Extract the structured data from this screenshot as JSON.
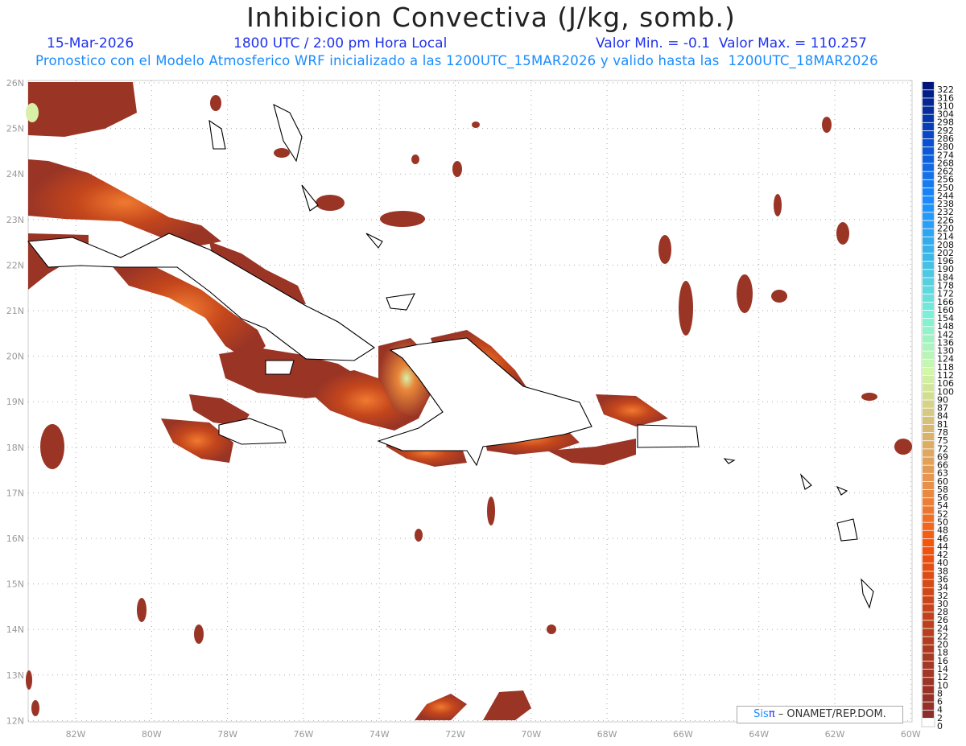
{
  "header": {
    "title": "Inhibicion Convectiva (J/kg, somb.)",
    "date": "15-Mar-2026",
    "time": "1800 UTC / 2:00 pm Hora Local",
    "min_max": "Valor Min. = -0.1  Valor Max. = 110.257",
    "subtitle": "Pronostico con el Modelo Atmosferico WRF inicializado a las 1200UTC_15MAR2026 y valido hasta las  1200UTC_18MAR2026"
  },
  "map": {
    "region": "Caribbean / Greater Antilles",
    "lon_labels": [
      "82W",
      "80W",
      "78W",
      "76W",
      "74W",
      "72W",
      "70W",
      "68W",
      "66W",
      "64W",
      "62W",
      "60W"
    ],
    "lat_labels": [
      "26N",
      "25N",
      "24N",
      "23N",
      "22N",
      "21N",
      "20N",
      "19N",
      "18N",
      "17N",
      "16N",
      "15N",
      "14N",
      "13N",
      "12N"
    ],
    "grid": "dotted",
    "shade_colors": {
      "low": "#9a3526",
      "mid": "#e8561a",
      "high": "#d8f0a8"
    }
  },
  "colorbar": {
    "labels": [
      "322",
      "316",
      "310",
      "304",
      "298",
      "292",
      "286",
      "280",
      "274",
      "268",
      "262",
      "256",
      "250",
      "244",
      "238",
      "232",
      "226",
      "220",
      "214",
      "208",
      "202",
      "196",
      "190",
      "184",
      "178",
      "172",
      "166",
      "160",
      "154",
      "148",
      "142",
      "136",
      "130",
      "124",
      "118",
      "112",
      "106",
      "100",
      "90",
      "87",
      "84",
      "81",
      "78",
      "75",
      "72",
      "69",
      "66",
      "63",
      "60",
      "58",
      "56",
      "54",
      "52",
      "50",
      "48",
      "46",
      "44",
      "42",
      "40",
      "38",
      "36",
      "34",
      "32",
      "30",
      "28",
      "26",
      "24",
      "22",
      "20",
      "18",
      "16",
      "14",
      "12",
      "10",
      "8",
      "6",
      "4",
      "2",
      "0"
    ],
    "color_stops": [
      "#00157a",
      "#0a4fd0",
      "#1a8cff",
      "#3cb8e8",
      "#7af0d8",
      "#d0f8a8",
      "#d8b870",
      "#e89048",
      "#f5560e",
      "#cc4418",
      "#a83a24",
      "#8e2e2a",
      "#ffffff"
    ]
  },
  "credit": {
    "brand_sis": "Sis",
    "brand_pi": "π",
    "text": "– ONAMET/REP.DOM."
  }
}
